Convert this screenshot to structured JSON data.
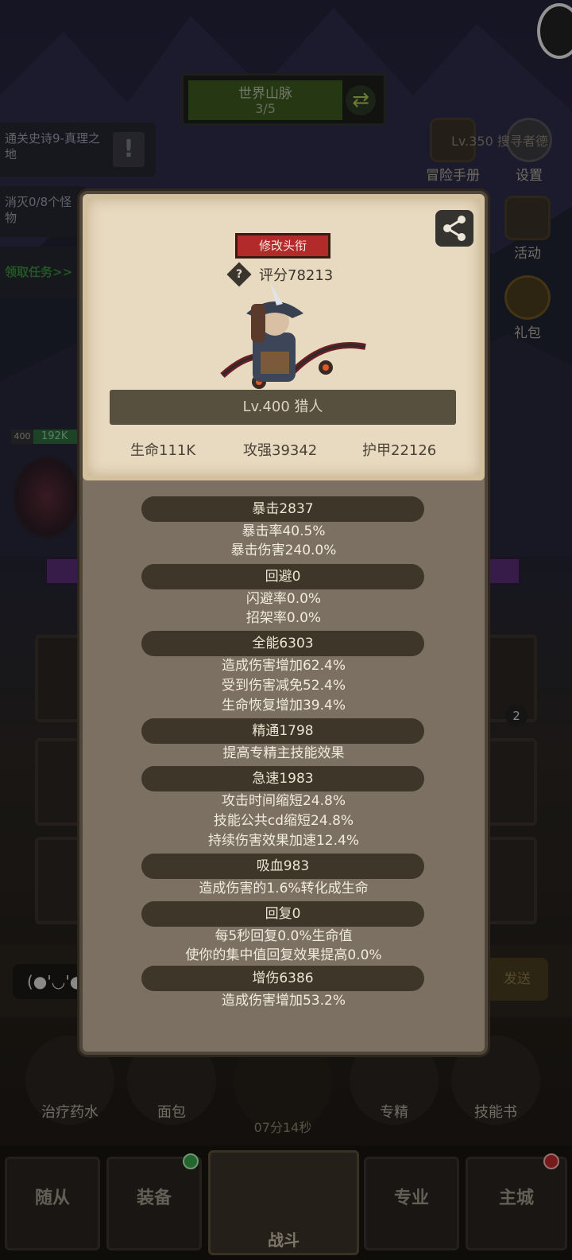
{
  "hud": {
    "world_title": "世界山脉",
    "world_progress": "3/5",
    "level_label": "Lv.350 搜寻者德",
    "quests": [
      {
        "text": "通关史诗9-真理之地"
      },
      {
        "text": "消灭0/8个怪物"
      },
      {
        "text": "领取任务>>"
      }
    ],
    "side_buttons": {
      "adventure": "冒险手册",
      "settings": "设置",
      "event": "活动",
      "gift": "礼包"
    },
    "unit": {
      "level": "400",
      "hp": "192K"
    },
    "slot_badge": "2",
    "chat_face": "(●'◡'●",
    "chat_send": "发送"
  },
  "consumables": {
    "potion": "治疗药水",
    "bread": "面包",
    "chest_timer": "07分14秒",
    "spec": "专精",
    "skillbook": "技能书"
  },
  "nav": {
    "follower": "随从",
    "equip": "装备",
    "battle": "战斗",
    "profession": "专业",
    "city": "主城"
  },
  "card": {
    "title_button": "修改头衔",
    "help_glyph": "?",
    "score": "评分78213",
    "level_class": "Lv.400 猎人",
    "hp": "生命111K",
    "attack": "攻强39342",
    "armor": "护甲22126"
  },
  "stats": [
    {
      "header": "暴击2837",
      "lines": [
        "暴击率40.5%",
        "暴击伤害240.0%"
      ]
    },
    {
      "header": "回避0",
      "lines": [
        "闪避率0.0%",
        "招架率0.0%"
      ]
    },
    {
      "header": "全能6303",
      "lines": [
        "造成伤害增加62.4%",
        "受到伤害减免52.4%",
        "生命恢复增加39.4%"
      ]
    },
    {
      "header": "精通1798",
      "lines": [
        "提高专精主技能效果"
      ]
    },
    {
      "header": "急速1983",
      "lines": [
        "攻击时间缩短24.8%",
        "技能公共cd缩短24.8%",
        "持续伤害效果加速12.4%"
      ]
    },
    {
      "header": "吸血983",
      "lines": [
        "造成伤害的1.6%转化成生命"
      ]
    },
    {
      "header": "回复0",
      "lines": [
        "每5秒回复0.0%生命值",
        "使你的集中值回复效果提高0.0%"
      ]
    },
    {
      "header": "增伤6386",
      "lines": [
        "造成伤害增加53.2%"
      ]
    }
  ],
  "colors": {
    "panel": "#7b7061",
    "card": "#e8dac0",
    "header_pill": "#3e3729",
    "title_button": "#b22a2a"
  }
}
